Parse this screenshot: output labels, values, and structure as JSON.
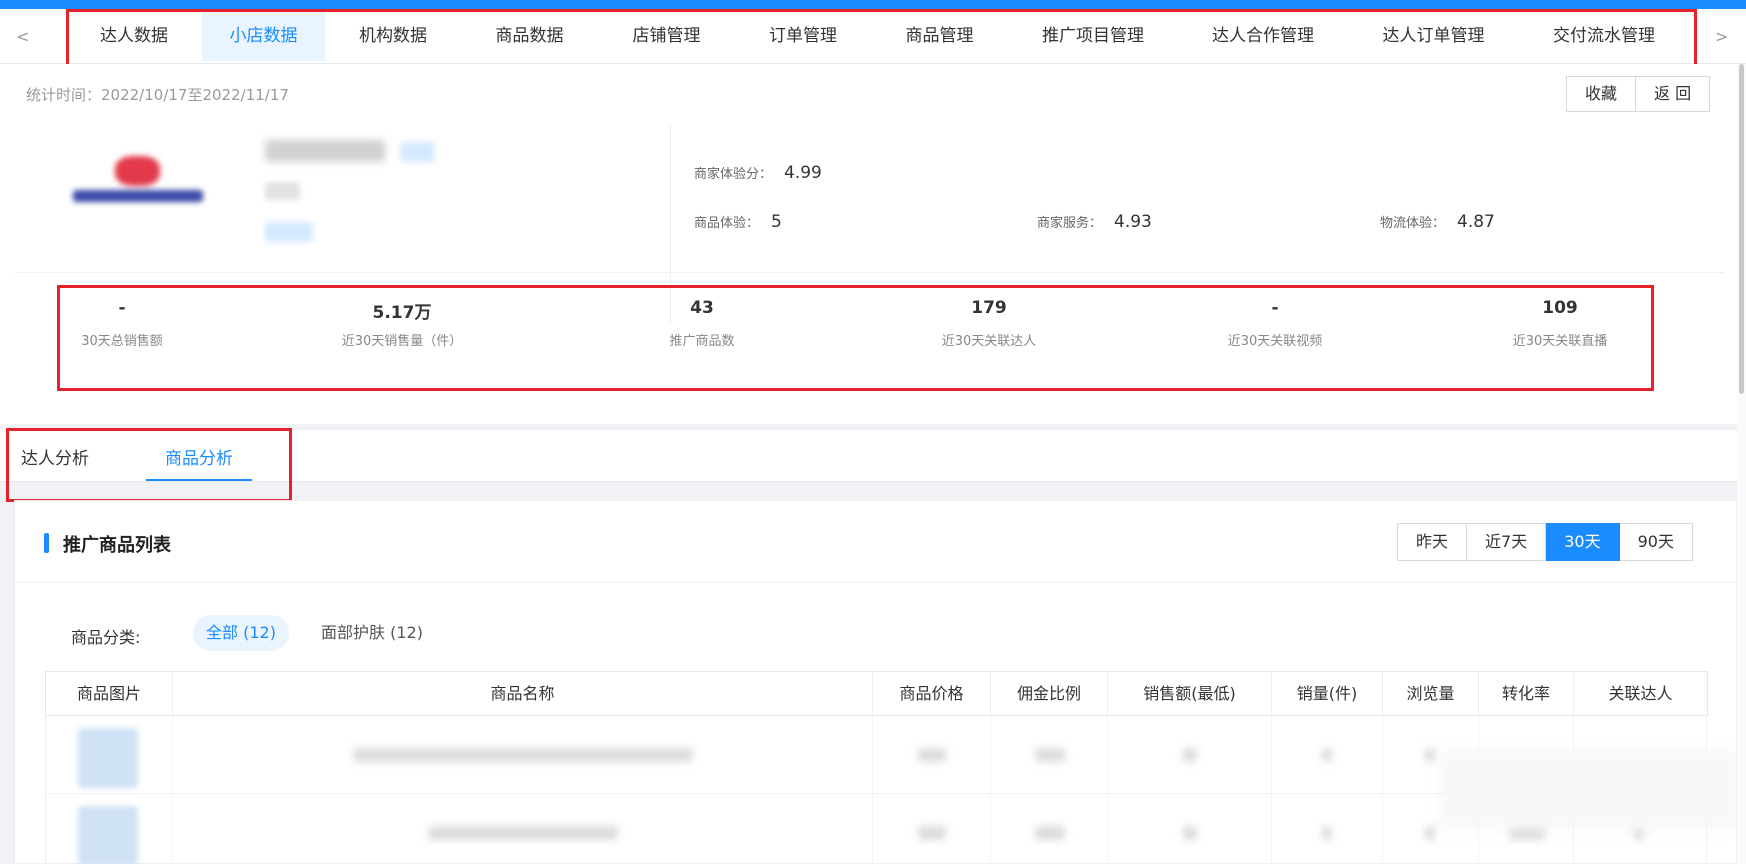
{
  "nav": {
    "prev": "<",
    "next": ">",
    "tabs": [
      "达人数据",
      "小店数据",
      "机构数据",
      "商品数据",
      "店铺管理",
      "订单管理",
      "商品管理",
      "推广项目管理",
      "达人合作管理",
      "达人订单管理",
      "交付流水管理"
    ],
    "active_index": 1
  },
  "header": {
    "stat_time": "统计时间：2022/10/17至2022/11/17",
    "favorite": "收藏",
    "back": "返 回"
  },
  "scores": {
    "merchant_experience_label": "商家体验分：",
    "merchant_experience_value": "4.99",
    "product_experience_label": "商品体验：",
    "product_experience_value": "5",
    "merchant_service_label": "商家服务：",
    "merchant_service_value": "4.93",
    "logistics_label": "物流体验：",
    "logistics_value": "4.87"
  },
  "metrics": [
    {
      "value": "-",
      "label": "30天总销售额"
    },
    {
      "value": "5.17万",
      "label": "近30天销售量（件）"
    },
    {
      "value": "43",
      "label": "推广商品数"
    },
    {
      "value": "179",
      "label": "近30天关联达人"
    },
    {
      "value": "-",
      "label": "近30天关联视频"
    },
    {
      "value": "109",
      "label": "近30天关联直播"
    }
  ],
  "subtabs": {
    "talent_analysis": "达人分析",
    "product_analysis": "商品分析"
  },
  "card": {
    "title": "推广商品列表",
    "ranges": [
      "昨天",
      "近7天",
      "30天",
      "90天"
    ],
    "active_range": 2
  },
  "filter": {
    "label": "商品分类:",
    "all": "全部 (12)",
    "facial": "面部护肤 (12)"
  },
  "table": {
    "columns": [
      "商品图片",
      "商品名称",
      "商品价格",
      "佣金比例",
      "销售额(最低)",
      "销量(件)",
      "浏览量",
      "转化率",
      "关联达人"
    ]
  },
  "colors": {
    "accent": "#1a8cff",
    "highlight_box": "#e6222c"
  }
}
